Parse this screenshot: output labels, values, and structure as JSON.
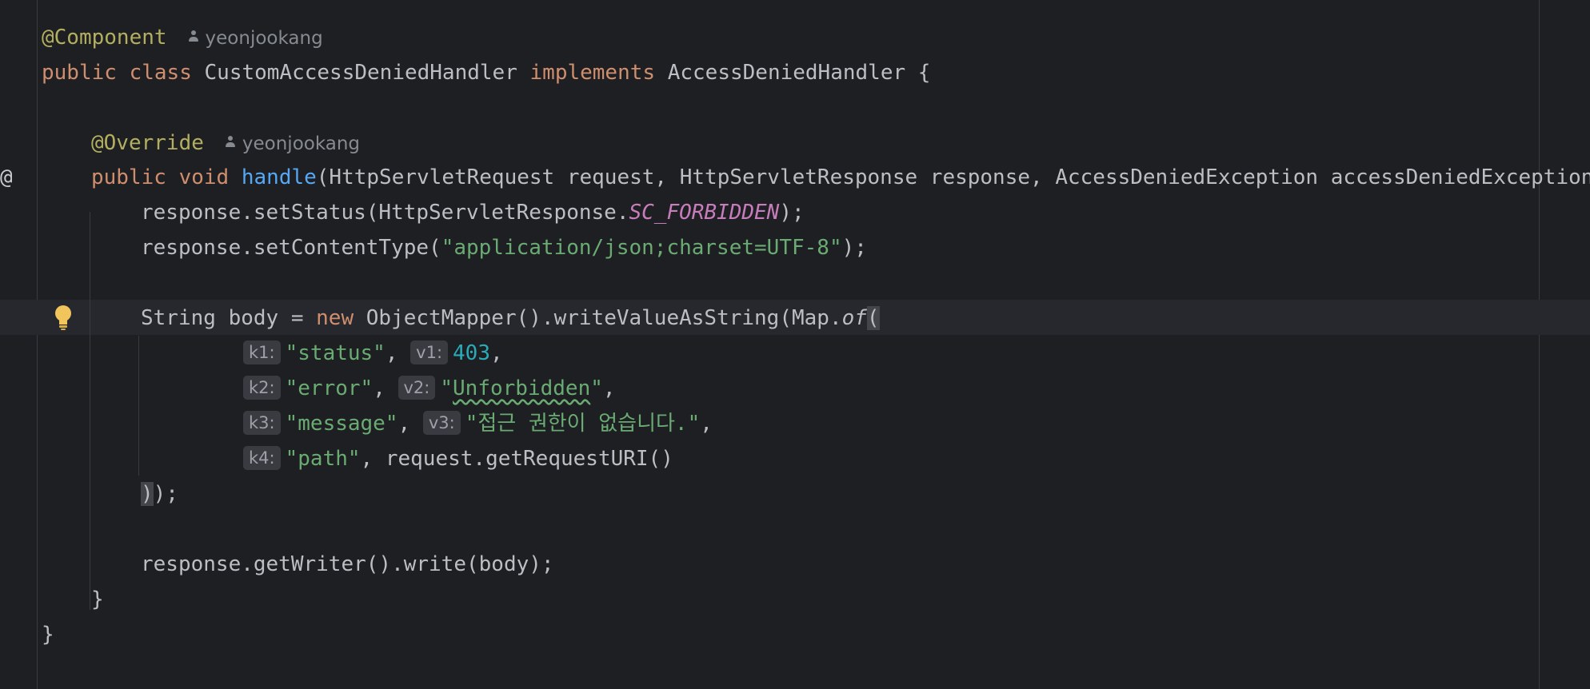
{
  "code": {
    "annotation_component": "@Component",
    "author_1": "yeonjookang",
    "class_public": "public",
    "class_keyword": "class",
    "class_name": "CustomAccessDeniedHandler",
    "implements_keyword": "implements",
    "interface_name": "AccessDeniedHandler",
    "open_brace": "{",
    "annotation_override": "@Override",
    "author_2": "yeonjookang",
    "method_public": "public",
    "method_void": "void",
    "method_name": "handle",
    "method_params": "(HttpServletRequest request, HttpServletResponse response, AccessDeniedException accessDeniedException",
    "set_status_prefix": "response.setStatus(HttpServletResponse.",
    "set_status_const": "SC_FORBIDDEN",
    "set_status_suffix": ");",
    "set_content_prefix": "response.setContentType(",
    "set_content_value": "\"application/json;charset=UTF-8\"",
    "set_content_suffix": ");",
    "body_prefix": "String body = ",
    "new_keyword": "new",
    "body_middle": " ObjectMapper().writeValueAsString(Map.",
    "of_method": "of",
    "open_paren": "(",
    "k1_hint": "k1:",
    "k1_value": "\"status\"",
    "v1_hint": "v1:",
    "v1_value": "403",
    "k2_hint": "k2:",
    "k2_value": "\"error\"",
    "v2_hint": "v2:",
    "v2_value_q1": "\"",
    "v2_value_word": "Unforbidden",
    "v2_value_q2": "\"",
    "k3_hint": "k3:",
    "k3_value": "\"message\"",
    "v3_hint": "v3:",
    "v3_value": "\"접근 권한이 없습니다.\"",
    "k4_hint": "k4:",
    "k4_value": "\"path\"",
    "k4_rest": ", request.getRequestURI()",
    "close_paren": ")",
    "close_tail": ");",
    "writer_line": "response.getWriter().write(body);",
    "method_close": "}",
    "class_close": "}",
    "gutter_at": "@"
  },
  "colors": {
    "background": "#1e1f22",
    "keyword": "#cf8e6d",
    "annotation": "#b3ae60",
    "string": "#6aab73",
    "number": "#2aacb8",
    "function": "#56a8f5",
    "constant": "#c77dbb"
  },
  "icons": {
    "gutter": "implementation-marker-icon",
    "bulb": "lightbulb-icon",
    "author": "person-icon"
  }
}
